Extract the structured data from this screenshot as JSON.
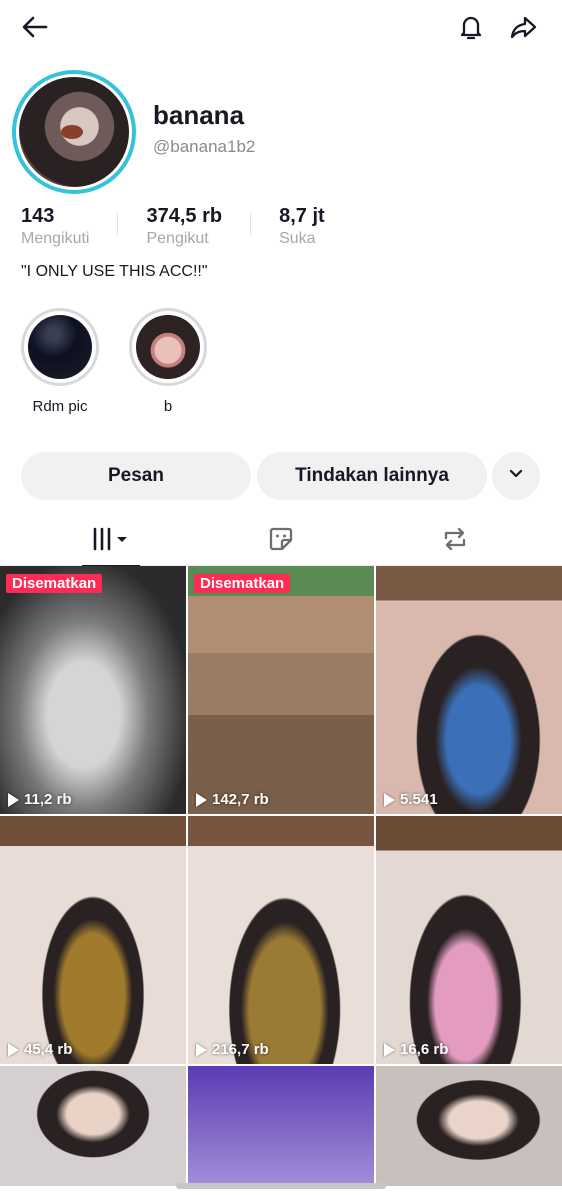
{
  "profile": {
    "display_name": "banana",
    "username": "@banana1b2",
    "bio": "\"I ONLY USE THIS ACC!!\""
  },
  "stats": [
    {
      "value": "143",
      "label": "Mengikuti"
    },
    {
      "value": "374,5 rb",
      "label": "Pengikut"
    },
    {
      "value": "8,7 jt",
      "label": "Suka"
    }
  ],
  "highlights": [
    {
      "label": "Rdm pic"
    },
    {
      "label": "b"
    }
  ],
  "actions": {
    "message": "Pesan",
    "more": "Tindakan lainnya"
  },
  "colors": {
    "avatar_ring": "#34c3d9",
    "pinned_badge": "#fe2c55",
    "button_bg": "#f1f1f2"
  },
  "icons": {
    "back": "back-arrow-icon",
    "notifications": "bell-icon",
    "share": "share-icon",
    "dropdown": "chevron-down-icon",
    "tab_videos": "videos-grid-icon",
    "tab_liked": "sticker-icon",
    "tab_reposts": "repost-icon"
  },
  "grid": [
    {
      "pinned_label": "Disematkan",
      "views": "11,2 rb"
    },
    {
      "pinned_label": "Disematkan",
      "views": "142,7 rb"
    },
    {
      "pinned_label": "",
      "views": "5.541"
    },
    {
      "pinned_label": "",
      "views": "45,4 rb"
    },
    {
      "pinned_label": "",
      "views": "216,7 rb"
    },
    {
      "pinned_label": "",
      "views": "16,6 rb"
    },
    {
      "pinned_label": "",
      "views": ""
    },
    {
      "pinned_label": "",
      "views": ""
    },
    {
      "pinned_label": "",
      "views": ""
    }
  ]
}
